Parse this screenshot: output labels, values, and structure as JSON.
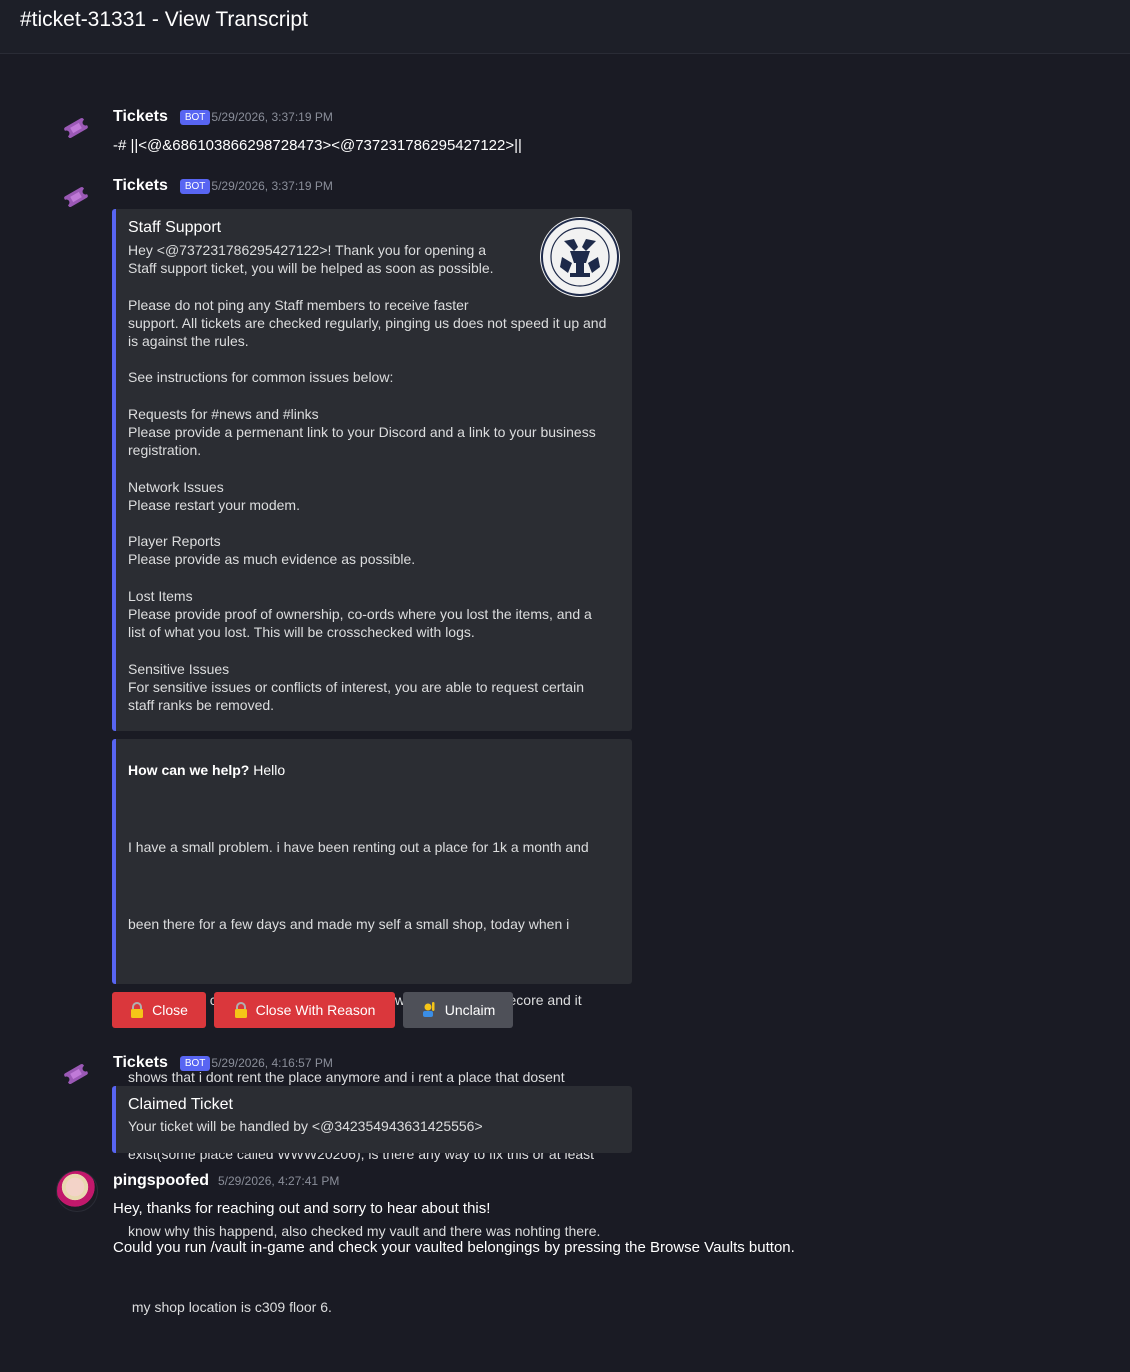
{
  "header": {
    "title": "#ticket-31331 - View Transcript"
  },
  "colors": {
    "accent": "#5865f2",
    "danger": "#da373c",
    "secondary": "#4e5058",
    "bot_icon": "#9b59b6"
  },
  "messages": [
    {
      "author": "Tickets",
      "badge": "BOT",
      "timestamp": "5/29/2026, 3:37:19 PM",
      "content": "-# ||<@&686103866298728473><@737231786295427122>||"
    },
    {
      "author": "Tickets",
      "badge": "BOT",
      "timestamp": "5/29/2026, 3:37:19 PM",
      "embed1": {
        "title": "Staff Support",
        "thumbnail_icon": "staff-team-logo-icon",
        "description": "Hey <@737231786295427122>! Thank you for opening a\nStaff support ticket, you will be helped as soon as possible.\n\nPlease do not ping any Staff members to receive faster\nsupport. All tickets are checked regularly, pinging us does not speed it up and\nis against the rules.\n\nSee instructions for common issues below:\n\nRequests for #news and #links\nPlease provide a permenant link to your Discord and a link to your business\nregistration.\n\nNetwork Issues\nPlease restart your modem.\n\nPlayer Reports\nPlease provide as much evidence as possible.\n\nLost Items\nPlease provide proof of ownership, co-ords where you lost the items, and a\nlist of what you lost. This will be crosschecked with logs.\n\nSensitive Issues\nFor sensitive issues or conflicts of interest, you are able to request certain\nstaff ranks be removed."
      },
      "embed2": {
        "question": "How can we help?",
        "answer_first": " Hello",
        "answer_lines": [
          "I have a small problem. i have been renting out a place for 1k a month and",
          "been there for a few days and made my self a small shop, today when i",
          "joined all my chest form my shop are gone with some of the decore and it",
          "shows that i dont rent the place anymore and i rent a place that dosent",
          "exist(some place called WWW20206), is there any way to fix this or at least",
          "know why this happend, also checked my vault and there was nohting there.",
          " my shop location is c309 floor 6."
        ]
      },
      "buttons": [
        {
          "label": "Close",
          "icon": "lock-icon"
        },
        {
          "label": "Close With Reason",
          "icon": "lock-icon"
        },
        {
          "label": "Unclaim",
          "icon": "raising-hand-icon"
        }
      ]
    },
    {
      "author": "Tickets",
      "badge": "BOT",
      "timestamp": "5/29/2026, 4:16:57 PM",
      "embed": {
        "title": "Claimed Ticket",
        "description": "Your ticket will be handled by <@342354943631425556>"
      }
    },
    {
      "author": "pingspoofed",
      "timestamp": "5/29/2026, 4:27:41 PM",
      "lines": [
        "Hey, thanks for reaching out and sorry to hear about this!",
        "Could you run /vault in-game and check your vaulted belongings by pressing the Browse Vaults button."
      ]
    }
  ]
}
